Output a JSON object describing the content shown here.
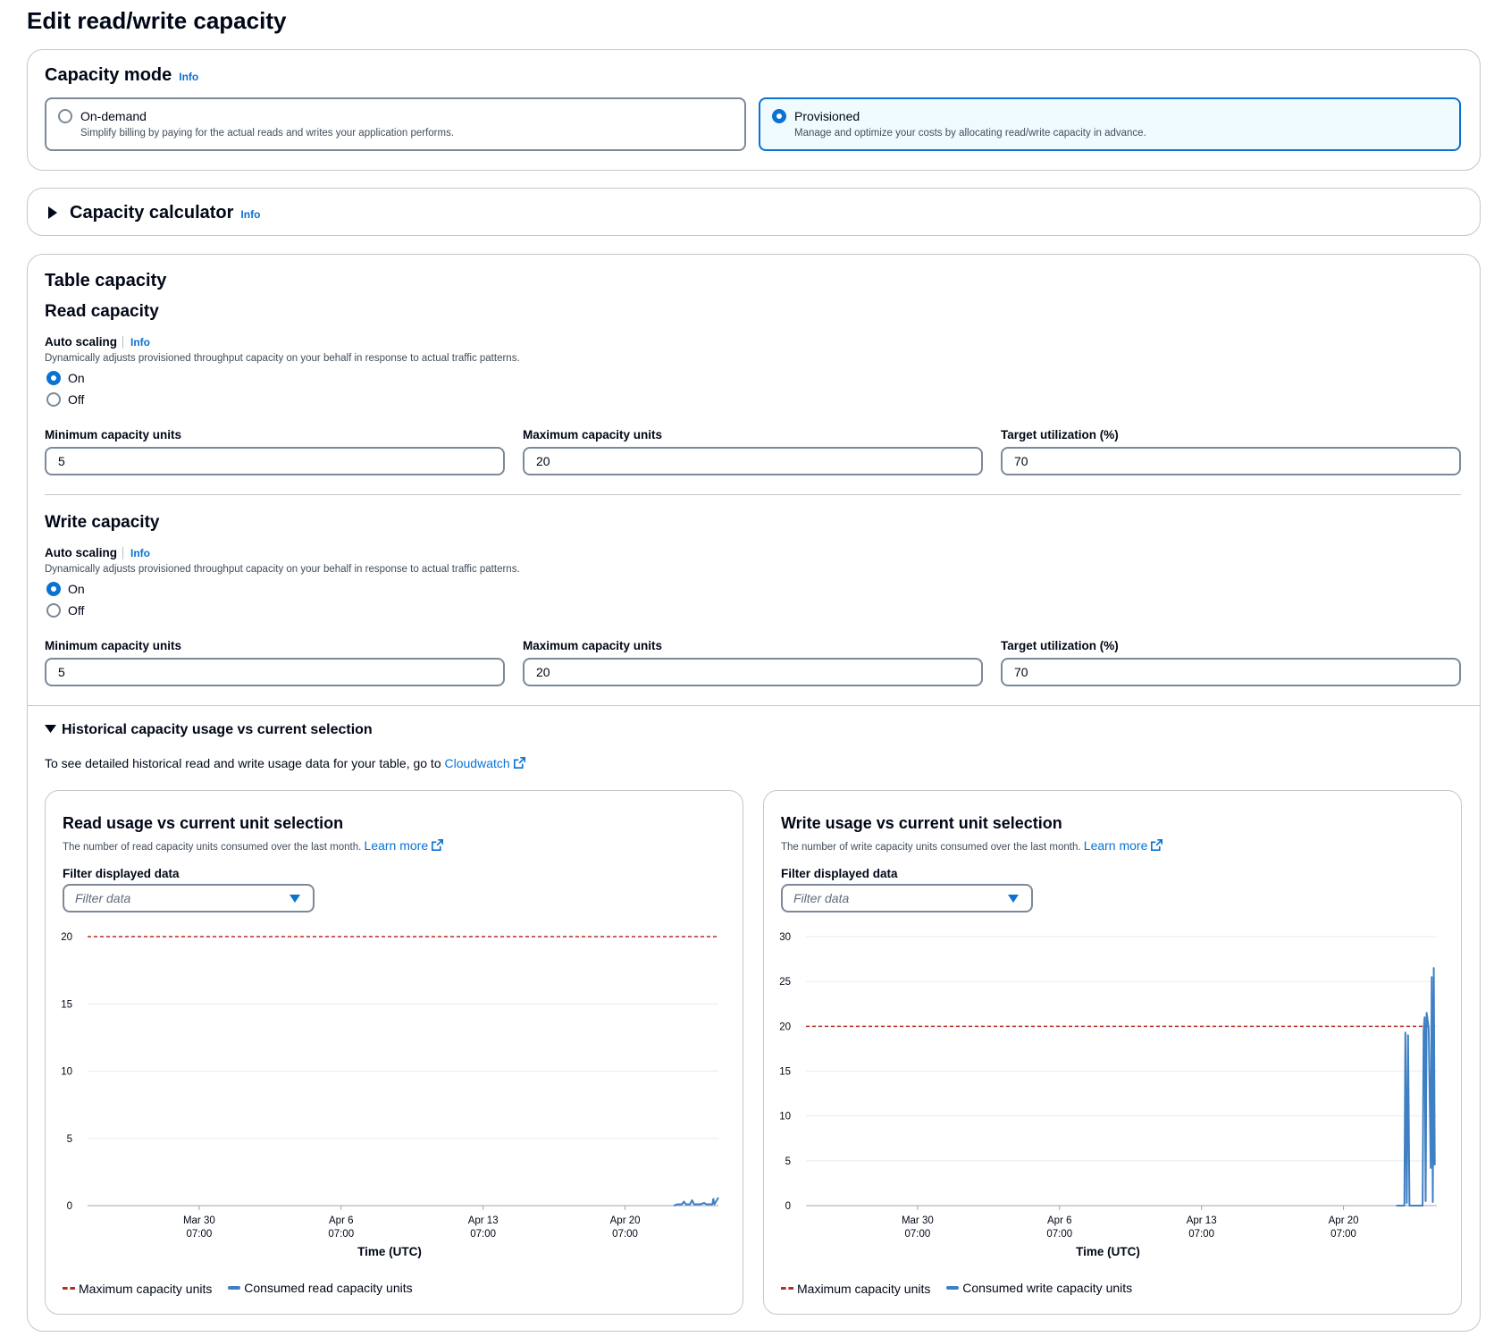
{
  "page_title": "Edit read/write capacity",
  "info_label": "Info",
  "capacity_mode": {
    "title": "Capacity mode",
    "options": [
      {
        "label": "On-demand",
        "description": "Simplify billing by paying for the actual reads and writes your application performs.",
        "selected": false
      },
      {
        "label": "Provisioned",
        "description": "Manage and optimize your costs by allocating read/write capacity in advance.",
        "selected": true
      }
    ]
  },
  "capacity_calculator": {
    "title": "Capacity calculator"
  },
  "table_capacity": {
    "title": "Table capacity",
    "read": {
      "title": "Read capacity",
      "auto_scaling_label": "Auto scaling",
      "auto_scaling_desc": "Dynamically adjusts provisioned throughput capacity on your behalf in response to actual traffic patterns.",
      "on_label": "On",
      "off_label": "Off",
      "min_label": "Minimum capacity units",
      "min_value": "5",
      "max_label": "Maximum capacity units",
      "max_value": "20",
      "target_label": "Target utilization (%)",
      "target_value": "70"
    },
    "write": {
      "title": "Write capacity",
      "auto_scaling_label": "Auto scaling",
      "auto_scaling_desc": "Dynamically adjusts provisioned throughput capacity on your behalf in response to actual traffic patterns.",
      "on_label": "On",
      "off_label": "Off",
      "min_label": "Minimum capacity units",
      "min_value": "5",
      "max_label": "Maximum capacity units",
      "max_value": "20",
      "target_label": "Target utilization (%)",
      "target_value": "70"
    }
  },
  "historical": {
    "title": "Historical capacity usage vs current selection",
    "text": "To see detailed historical read and write usage data for your table, go to",
    "link": "Cloudwatch"
  },
  "read_chart": {
    "title": "Read usage vs current unit selection",
    "subtitle": "The number of read capacity units consumed over the last month.",
    "learn_more": "Learn more",
    "filter_label": "Filter displayed data",
    "filter_placeholder": "Filter data",
    "legend_max": "Maximum capacity units",
    "legend_consumed": "Consumed read capacity units"
  },
  "write_chart": {
    "title": "Write usage vs current unit selection",
    "subtitle": "The number of write capacity units consumed over the last month.",
    "learn_more": "Learn more",
    "filter_label": "Filter displayed data",
    "filter_placeholder": "Filter data",
    "legend_max": "Maximum capacity units",
    "legend_consumed": "Consumed write capacity units"
  },
  "chart_data": [
    {
      "type": "line",
      "xlabel": "Time (UTC)",
      "ylabel": "",
      "ylim": [
        0,
        20
      ],
      "yticks": [
        "0",
        "5",
        "10",
        "15",
        "20"
      ],
      "xticks": [
        {
          "label": "Mar 30",
          "sub": "07:00",
          "day": 0
        },
        {
          "label": "Apr 6",
          "sub": "07:00",
          "day": 7
        },
        {
          "label": "Apr 13",
          "sub": "07:00",
          "day": 14
        },
        {
          "label": "Apr 20",
          "sub": "07:00",
          "day": 21
        }
      ],
      "x_range_days": [
        -5.5,
        25.6
      ],
      "series": [
        {
          "name": "Maximum capacity units",
          "style": "dashed",
          "color": "#b72d20",
          "constant": 20
        },
        {
          "name": "Consumed read capacity units",
          "style": "solid",
          "color": "#3f7fc4",
          "points": [
            [
              23.4,
              0
            ],
            [
              23.6,
              0.1
            ],
            [
              23.8,
              0.1
            ],
            [
              23.9,
              0.3
            ],
            [
              24.0,
              0.1
            ],
            [
              24.2,
              0.1
            ],
            [
              24.3,
              0.4
            ],
            [
              24.4,
              0.1
            ],
            [
              24.7,
              0.1
            ],
            [
              24.9,
              0.2
            ],
            [
              25.0,
              0.1
            ],
            [
              25.3,
              0.1
            ],
            [
              25.35,
              0.5
            ],
            [
              25.4,
              0.1
            ],
            [
              25.6,
              0.6
            ]
          ]
        }
      ]
    },
    {
      "type": "line",
      "xlabel": "Time (UTC)",
      "ylabel": "",
      "ylim": [
        0,
        30
      ],
      "yticks": [
        "0",
        "5",
        "10",
        "15",
        "20",
        "25",
        "30"
      ],
      "xticks": [
        {
          "label": "Mar 30",
          "sub": "07:00",
          "day": 0
        },
        {
          "label": "Apr 6",
          "sub": "07:00",
          "day": 7
        },
        {
          "label": "Apr 13",
          "sub": "07:00",
          "day": 14
        },
        {
          "label": "Apr 20",
          "sub": "07:00",
          "day": 21
        }
      ],
      "x_range_days": [
        -5.5,
        25.6
      ],
      "series": [
        {
          "name": "Maximum capacity units",
          "style": "dashed",
          "color": "#b72d20",
          "constant": 20
        },
        {
          "name": "Consumed write capacity units",
          "style": "solid",
          "color": "#3f7fc4",
          "points": [
            [
              23.6,
              0
            ],
            [
              24.0,
              0
            ],
            [
              24.05,
              19.3
            ],
            [
              24.12,
              0.3
            ],
            [
              24.18,
              19.0
            ],
            [
              24.25,
              0
            ],
            [
              24.9,
              0
            ],
            [
              24.95,
              19.5
            ],
            [
              25.0,
              21.0
            ],
            [
              25.05,
              0.5
            ],
            [
              25.1,
              21.5
            ],
            [
              25.2,
              19.8
            ],
            [
              25.3,
              4.2
            ],
            [
              25.35,
              25.5
            ],
            [
              25.4,
              0.4
            ],
            [
              25.45,
              26.5
            ],
            [
              25.5,
              4.5
            ]
          ]
        }
      ]
    }
  ],
  "colors": {
    "accent": "#0972d3",
    "max_line": "#b72d20",
    "consumed": "#3f7fc4"
  }
}
